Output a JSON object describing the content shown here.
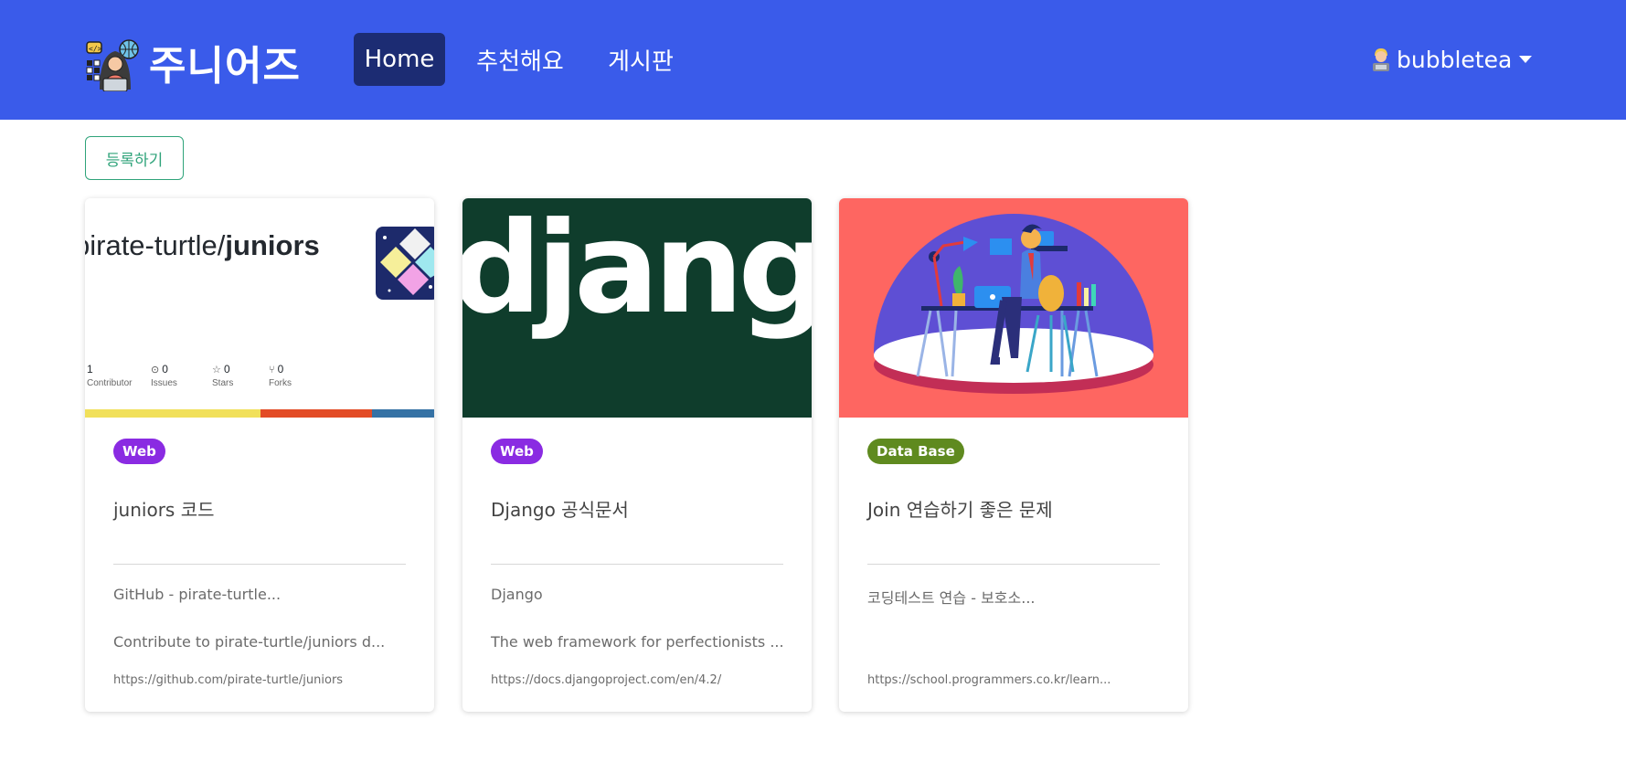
{
  "navbar": {
    "brand": "주니어즈",
    "items": [
      "Home",
      "추천해요",
      "게시판"
    ],
    "active_index": 0,
    "user": "bubbletea",
    "bg_color": "#3a5bea"
  },
  "actions": {
    "register_label": "등록하기"
  },
  "cards": [
    {
      "badge": "Web",
      "badge_color": "#8a2be2",
      "title": "juniors 코드",
      "site": "GitHub - pirate-turtle...",
      "desc": "Contribute to pirate-turtle/juniors d...",
      "url": "https://github.com/pirate-turtle/juniors",
      "preview": {
        "repo_prefix": "pirate-turtle/",
        "repo_name": "juniors",
        "stats": [
          {
            "num": "1",
            "label": "Contributor"
          },
          {
            "num": "0",
            "label": "Issues"
          },
          {
            "num": "0",
            "label": "Stars"
          },
          {
            "num": "0",
            "label": "Forks"
          }
        ]
      }
    },
    {
      "badge": "Web",
      "badge_color": "#8a2be2",
      "title": "Django 공식문서",
      "site": "Django",
      "desc": "The web framework for perfectionists ...",
      "url": "https://docs.djangoproject.com/en/4.2/",
      "preview": {
        "word": "django"
      }
    },
    {
      "badge": "Data Base",
      "badge_color": "#5f8a1f",
      "title": "Join 연습하기 좋은 문제",
      "site": "코딩테스트 연습 - 보호소...",
      "desc": "",
      "url": "https://school.programmers.co.kr/learn..."
    }
  ]
}
